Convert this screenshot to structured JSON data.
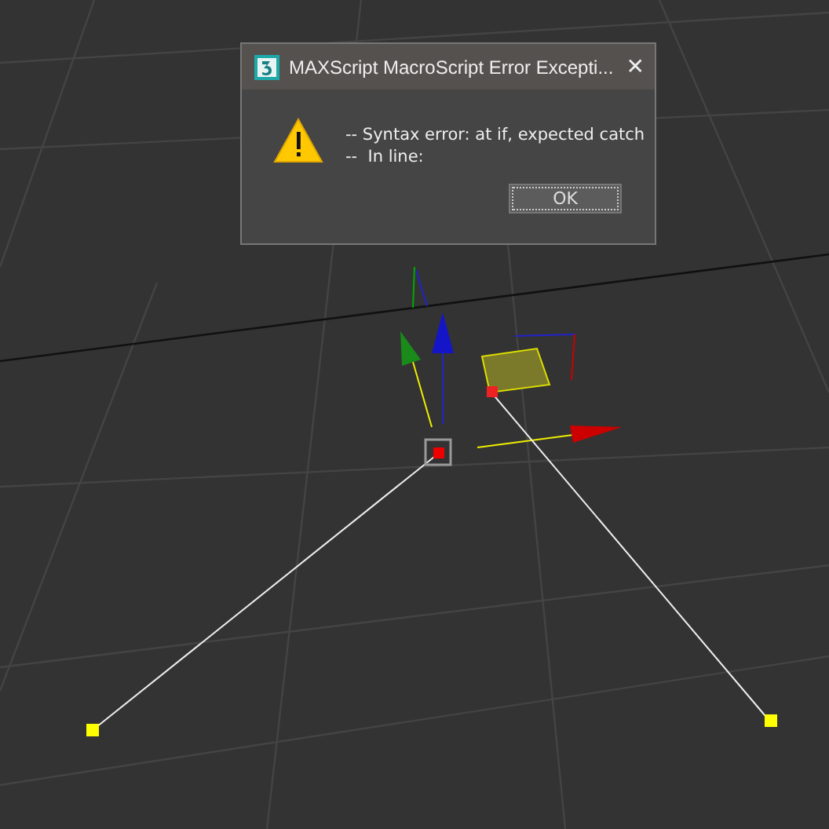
{
  "dialog": {
    "title": "MAXScript MacroScript Error Excepti...",
    "close": "✕",
    "message": [
      "-- Syntax error: at if, expected catch",
      "--  In line:"
    ],
    "buttons": [
      {
        "label": "OK",
        "focused": true
      }
    ]
  }
}
